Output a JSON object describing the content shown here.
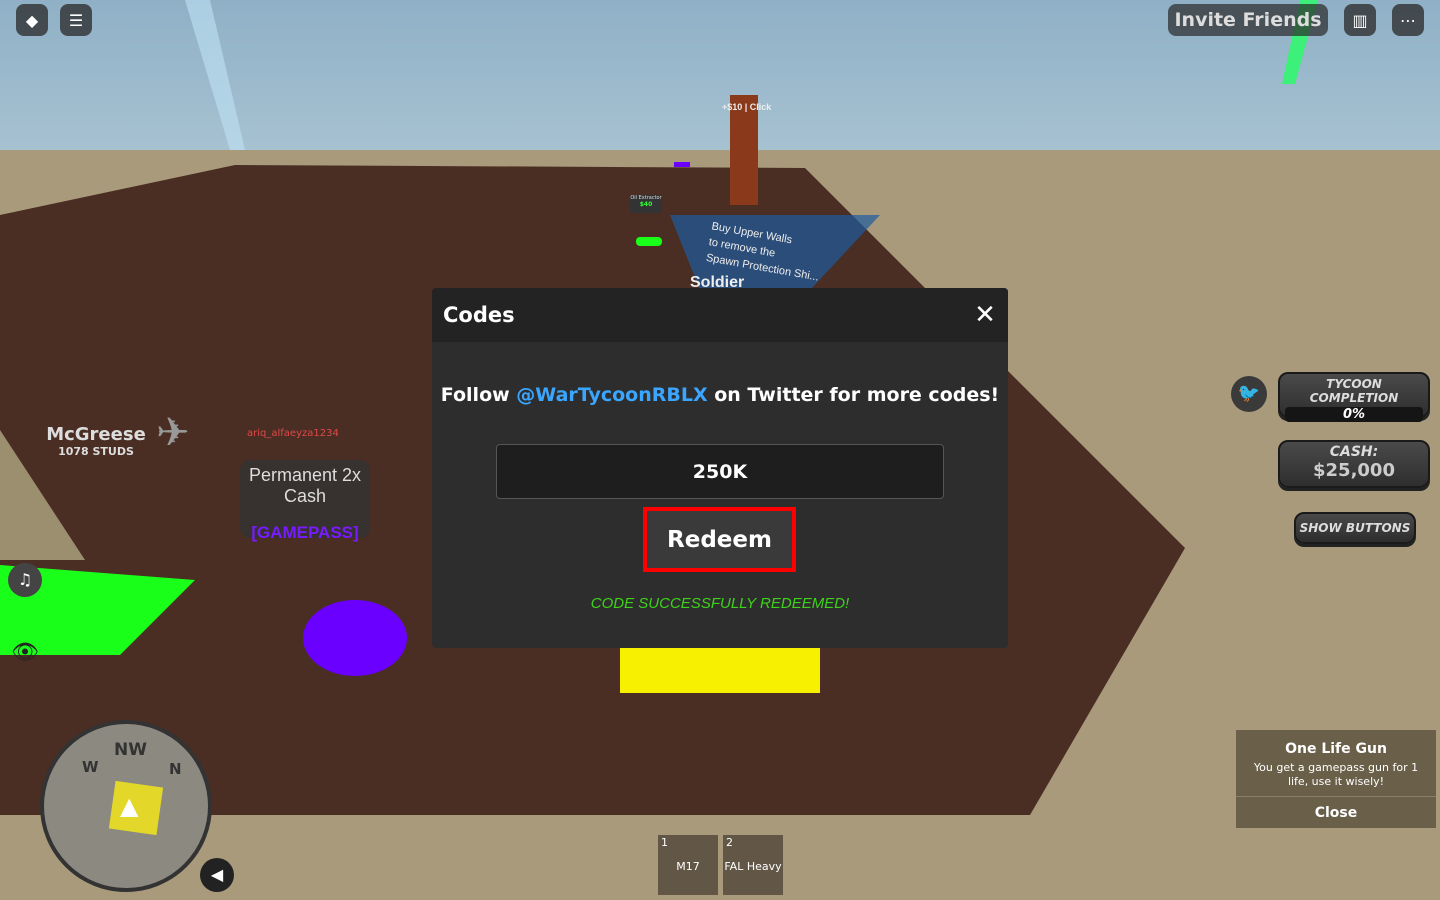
{
  "topbar": {
    "invite_label": "Invite Friends",
    "icons": [
      "roblox-logo-icon",
      "chat-icon",
      "leaderboard-icon",
      "more-icon"
    ]
  },
  "world": {
    "click_label": "+$10 | Click",
    "oil_name": "Oil Extractor",
    "oil_price": "$40",
    "sign_lines": [
      "Buy Upper Walls",
      "to remove the",
      "Spawn Protection Shi..."
    ],
    "soldier": "Soldier",
    "player_name": "McGreese",
    "player_distance": "1078 STUDS",
    "other_player": "ariq_alfaeyza1234",
    "gamepass_title": "Permanent 2x Cash",
    "gamepass_tag": "[GAMEPASS]"
  },
  "codes_modal": {
    "title": "Codes",
    "follow_prefix": "Follow ",
    "follow_handle": "@WarTycoonRBLX",
    "follow_suffix": " on Twitter for more codes!",
    "code_value": "250K",
    "redeem_label": "Redeem",
    "status": "CODE SUCCESSFULLY REDEEMED!",
    "status_color": "#3ed31a",
    "accent": "#3aa6ff"
  },
  "hud": {
    "tycoon_label": "TYCOON COMPLETION",
    "tycoon_value": "0%",
    "tycoon_progress": 0,
    "cash_label": "CASH:",
    "cash_value": "$25,000",
    "show_buttons": "SHOW BUTTONS"
  },
  "info_panel": {
    "title": "One Life Gun",
    "desc": "You get a gamepass gun for 1 life, use it wisely!",
    "close": "Close"
  },
  "minimap": {
    "labels": [
      "NW",
      "W",
      "N"
    ]
  },
  "hotbar": [
    {
      "key": "1",
      "name": "M17"
    },
    {
      "key": "2",
      "name": "FAL Heavy"
    }
  ]
}
